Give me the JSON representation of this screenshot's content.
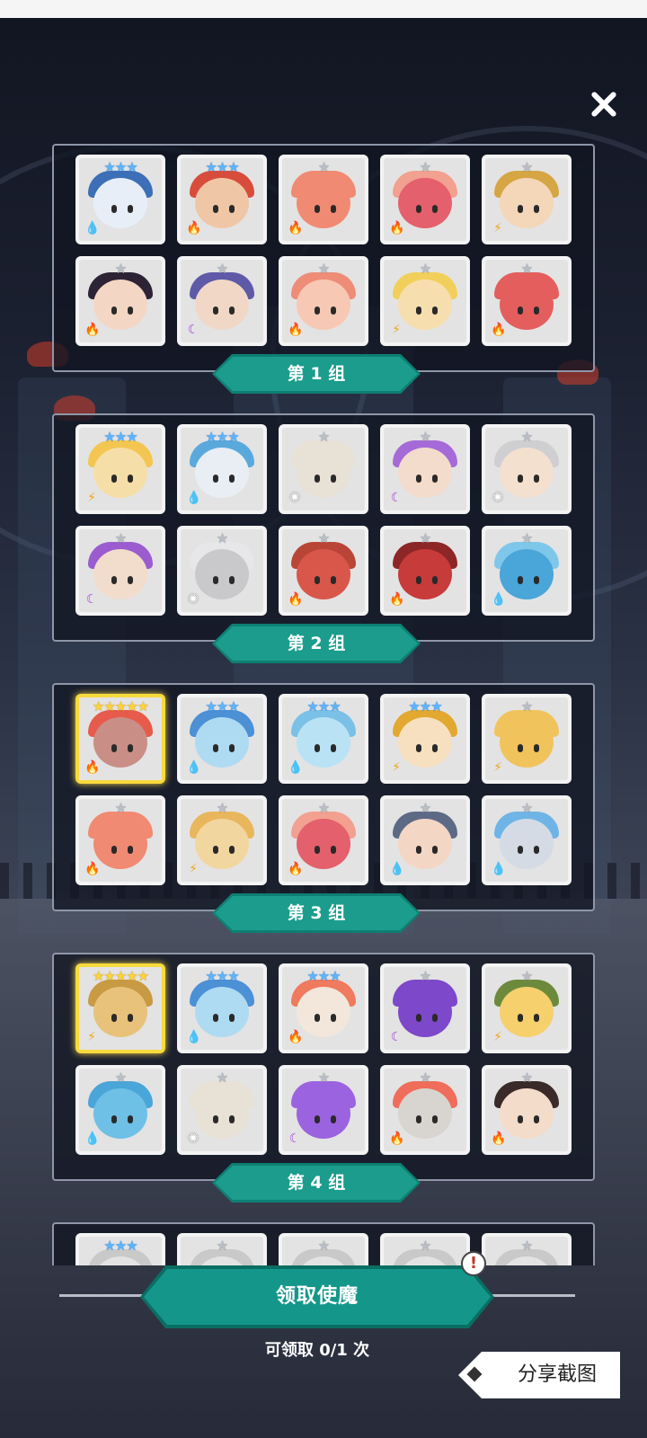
{
  "close_label": "✕",
  "groups": [
    {
      "label": "第 1 组",
      "heroes": [
        {
          "stars": 3,
          "star_text": "★★★",
          "element": "water",
          "element_icon": "💧",
          "color": "#e8eef8",
          "hat": "#3d6fb6"
        },
        {
          "stars": 3,
          "star_text": "★★★",
          "element": "fire",
          "element_icon": "🔥",
          "color": "#f0c7a6",
          "hat": "#d84c3b"
        },
        {
          "stars": 1,
          "star_text": "★",
          "element": "fire",
          "element_icon": "🔥",
          "color": "#f18a72",
          "hat": "#f18a72"
        },
        {
          "stars": 1,
          "star_text": "★",
          "element": "fire",
          "element_icon": "🔥",
          "color": "#e4606c",
          "hat": "#f2a08f"
        },
        {
          "stars": 1,
          "star_text": "★",
          "element": "thunder",
          "element_icon": "⚡",
          "color": "#f4d6b8",
          "hat": "#d6a544"
        },
        {
          "stars": 1,
          "star_text": "★",
          "element": "fire",
          "element_icon": "🔥",
          "color": "#f4d6c4",
          "hat": "#2c2335"
        },
        {
          "stars": 1,
          "star_text": "★",
          "element": "dark",
          "element_icon": "☾",
          "color": "#f1d8c6",
          "hat": "#5e5aa8"
        },
        {
          "stars": 1,
          "star_text": "★",
          "element": "fire",
          "element_icon": "🔥",
          "color": "#f7c9b4",
          "hat": "#ee8c78"
        },
        {
          "stars": 1,
          "star_text": "★",
          "element": "thunder",
          "element_icon": "⚡",
          "color": "#f6deae",
          "hat": "#f2cf5a"
        },
        {
          "stars": 1,
          "star_text": "★",
          "element": "fire",
          "element_icon": "🔥",
          "color": "#e45e5e",
          "hat": "#e45e5e"
        }
      ]
    },
    {
      "label": "第 2 组",
      "heroes": [
        {
          "stars": 3,
          "star_text": "★★★",
          "element": "thunder",
          "element_icon": "⚡",
          "color": "#f6dea8",
          "hat": "#f2c651"
        },
        {
          "stars": 3,
          "star_text": "★★★",
          "element": "water",
          "element_icon": "💧",
          "color": "#e9eef4",
          "hat": "#5aa9dd"
        },
        {
          "stars": 1,
          "star_text": "★",
          "element": "light",
          "element_icon": "✺",
          "color": "#e8e1d6",
          "hat": "#e8e1d6"
        },
        {
          "stars": 1,
          "star_text": "★",
          "element": "dark",
          "element_icon": "☾",
          "color": "#f3dccb",
          "hat": "#a56ad8"
        },
        {
          "stars": 1,
          "star_text": "★",
          "element": "light",
          "element_icon": "✺",
          "color": "#f4e0cf",
          "hat": "#cfcfd2"
        },
        {
          "stars": 1,
          "star_text": "★",
          "element": "dark",
          "element_icon": "☾",
          "color": "#f2dccc",
          "hat": "#9a5ccf"
        },
        {
          "stars": 1,
          "star_text": "★",
          "element": "light",
          "element_icon": "✺",
          "color": "#c9c9cc",
          "hat": "#e7e7ea"
        },
        {
          "stars": 1,
          "star_text": "★",
          "element": "fire",
          "element_icon": "🔥",
          "color": "#d9574a",
          "hat": "#b94537"
        },
        {
          "stars": 1,
          "star_text": "★",
          "element": "fire",
          "element_icon": "🔥",
          "color": "#c73b3b",
          "hat": "#8d2626"
        },
        {
          "stars": 1,
          "star_text": "★",
          "element": "water",
          "element_icon": "💧",
          "color": "#4aa5d8",
          "hat": "#7fc7ea"
        }
      ]
    },
    {
      "label": "第 3 组",
      "heroes": [
        {
          "stars": 5,
          "star_text": "★★★★★",
          "element": "fire",
          "element_icon": "🔥",
          "color": "#c98f87",
          "hat": "#e65b4b",
          "gold": true
        },
        {
          "stars": 3,
          "star_text": "★★★",
          "element": "water",
          "element_icon": "💧",
          "color": "#aedaf2",
          "hat": "#4c90d6"
        },
        {
          "stars": 3,
          "star_text": "★★★",
          "element": "water",
          "element_icon": "💧",
          "color": "#b9e3f4",
          "hat": "#7bc0e6"
        },
        {
          "stars": 3,
          "star_text": "★★★",
          "element": "thunder",
          "element_icon": "⚡",
          "color": "#f6e0bf",
          "hat": "#e2a830"
        },
        {
          "stars": 1,
          "star_text": "★",
          "element": "thunder",
          "element_icon": "⚡",
          "color": "#f1c35d",
          "hat": "#f1c35d"
        },
        {
          "stars": 1,
          "star_text": "★",
          "element": "fire",
          "element_icon": "🔥",
          "color": "#f18a72",
          "hat": "#f18a72"
        },
        {
          "stars": 1,
          "star_text": "★",
          "element": "thunder",
          "element_icon": "⚡",
          "color": "#f2d6a0",
          "hat": "#e8b65c"
        },
        {
          "stars": 1,
          "star_text": "★",
          "element": "fire",
          "element_icon": "🔥",
          "color": "#e4606c",
          "hat": "#f2a08f"
        },
        {
          "stars": 1,
          "star_text": "★",
          "element": "water",
          "element_icon": "💧",
          "color": "#f4d6c4",
          "hat": "#5d6a86"
        },
        {
          "stars": 1,
          "star_text": "★",
          "element": "water",
          "element_icon": "💧",
          "color": "#d4dbe4",
          "hat": "#6fb4e6"
        }
      ]
    },
    {
      "label": "第 4 组",
      "heroes": [
        {
          "stars": 5,
          "star_text": "★★★★★",
          "element": "thunder",
          "element_icon": "⚡",
          "color": "#e8c27a",
          "hat": "#c99a44",
          "gold": true
        },
        {
          "stars": 3,
          "star_text": "★★★",
          "element": "water",
          "element_icon": "💧",
          "color": "#aedaf2",
          "hat": "#4c90d6"
        },
        {
          "stars": 3,
          "star_text": "★★★",
          "element": "fire",
          "element_icon": "🔥",
          "color": "#f3e6db",
          "hat": "#ef7a5e"
        },
        {
          "stars": 1,
          "star_text": "★",
          "element": "dark",
          "element_icon": "☾",
          "color": "#7d48c9",
          "hat": "#7d48c9"
        },
        {
          "stars": 1,
          "star_text": "★",
          "element": "thunder",
          "element_icon": "⚡",
          "color": "#f6d06c",
          "hat": "#6c8a3c"
        },
        {
          "stars": 1,
          "star_text": "★",
          "element": "water",
          "element_icon": "💧",
          "color": "#6fc0e6",
          "hat": "#4aa5d8"
        },
        {
          "stars": 1,
          "star_text": "★",
          "element": "light",
          "element_icon": "✺",
          "color": "#e8e1d6",
          "hat": "#e8e1d6"
        },
        {
          "stars": 1,
          "star_text": "★",
          "element": "dark",
          "element_icon": "☾",
          "color": "#9b63e0",
          "hat": "#9b63e0"
        },
        {
          "stars": 1,
          "star_text": "★",
          "element": "fire",
          "element_icon": "🔥",
          "color": "#d8d4d0",
          "hat": "#ef6d5a"
        },
        {
          "stars": 1,
          "star_text": "★",
          "element": "fire",
          "element_icon": "🔥",
          "color": "#f3dcc9",
          "hat": "#3a2a2a"
        }
      ]
    },
    {
      "label": "",
      "heroes": [
        {
          "stars": 3,
          "star_text": "★★★",
          "element": "",
          "element_icon": "",
          "color": "#e3e3e3",
          "hat": "#c9c9c9"
        },
        {
          "stars": 1,
          "star_text": "★",
          "element": "",
          "element_icon": "",
          "color": "#e3e3e3",
          "hat": "#c9c9c9"
        },
        {
          "stars": 1,
          "star_text": "★",
          "element": "",
          "element_icon": "",
          "color": "#e3e3e3",
          "hat": "#c9c9c9"
        },
        {
          "stars": 1,
          "star_text": "★",
          "element": "",
          "element_icon": "",
          "color": "#e3e3e3",
          "hat": "#c9c9c9"
        },
        {
          "stars": 1,
          "star_text": "★",
          "element": "",
          "element_icon": "",
          "color": "#e3e3e3",
          "hat": "#c9c9c9"
        }
      ]
    }
  ],
  "claim_button_label": "领取使魔",
  "claim_alert_icon": "!",
  "claim_count": "可领取 0/1 次",
  "share_button_label": "分享截图",
  "colors": {
    "accent": "#14978a",
    "accent_dark": "#0a6e63",
    "gold_frame": "#f7da3c"
  }
}
